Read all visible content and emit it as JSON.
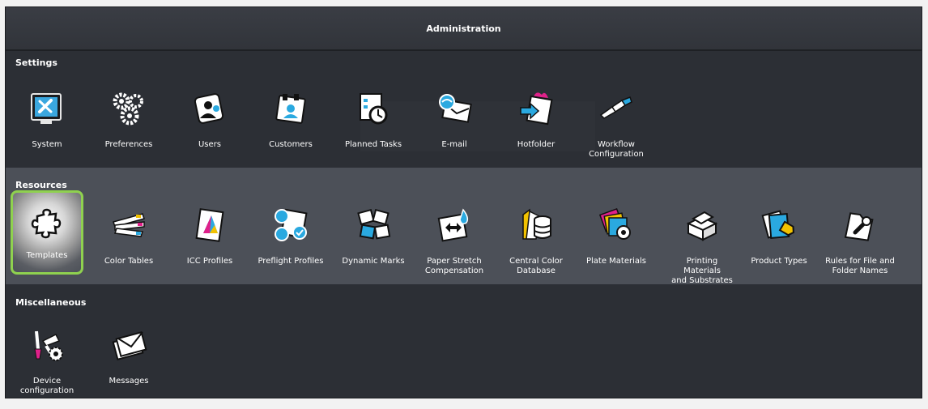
{
  "window": {
    "title": "Administration"
  },
  "sections": {
    "settings": {
      "label": "Settings",
      "items": [
        {
          "label": "System",
          "icon": "system-icon"
        },
        {
          "label": "Preferences",
          "icon": "gears-icon"
        },
        {
          "label": "Users",
          "icon": "users-icon"
        },
        {
          "label": "Customers",
          "icon": "customers-icon"
        },
        {
          "label": "Planned Tasks",
          "icon": "clock-icon"
        },
        {
          "label": "E-mail",
          "icon": "email-icon"
        },
        {
          "label": "Hotfolder",
          "icon": "hotfolder-icon"
        },
        {
          "label": "Workflow\nConfiguration",
          "icon": "workflow-icon"
        }
      ]
    },
    "resources": {
      "label": "Resources",
      "items": [
        {
          "label": "Templates",
          "icon": "puzzle-icon",
          "selected": true
        },
        {
          "label": "Color Tables",
          "icon": "color-fan-icon"
        },
        {
          "label": "ICC Profiles",
          "icon": "icc-profile-icon"
        },
        {
          "label": "Preflight Profiles",
          "icon": "preflight-icon"
        },
        {
          "label": "Dynamic Marks",
          "icon": "dynamic-marks-icon"
        },
        {
          "label": "Paper Stretch\nCompensation",
          "icon": "paper-stretch-icon"
        },
        {
          "label": "Central Color\nDatabase",
          "icon": "database-icon"
        },
        {
          "label": "Plate Materials",
          "icon": "plate-materials-icon"
        },
        {
          "label": "Printing Materials\nand Substrates",
          "icon": "substrates-icon"
        },
        {
          "label": "Product Types",
          "icon": "product-types-icon"
        },
        {
          "label": "Rules for File and\nFolder Names",
          "icon": "rules-icon"
        }
      ]
    },
    "misc": {
      "label": "Miscellaneous",
      "items": [
        {
          "label": "Device\nconfiguration",
          "icon": "device-config-icon"
        },
        {
          "label": "Messages",
          "icon": "messages-icon"
        }
      ]
    }
  },
  "colors": {
    "selection": "#8fd14f",
    "accent_blue": "#2aa9e0"
  }
}
